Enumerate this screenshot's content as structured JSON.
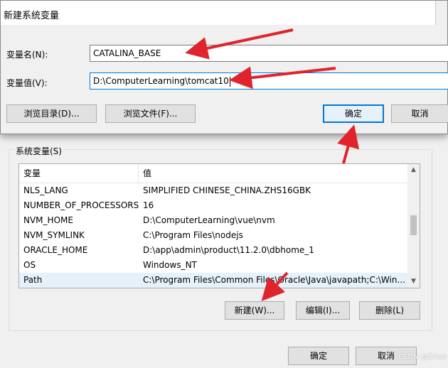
{
  "dialog": {
    "title": "新建系统变量",
    "name_label": "变量名(N):",
    "name_value": "CATALINA_BASE",
    "value_label": "变量值(V):",
    "value_value": "D:\\ComputerLearning\\tomcat10",
    "browse_dir_button": "浏览目录(D)...",
    "browse_file_button": "浏览文件(F)...",
    "ok_button": "确定",
    "cancel_button": "取消"
  },
  "system_vars": {
    "group_label": "系统变量(S)",
    "columns": [
      "变量",
      "值"
    ],
    "rows": [
      {
        "name": "NLS_LANG",
        "value": "SIMPLIFIED CHINESE_CHINA.ZHS16GBK"
      },
      {
        "name": "NUMBER_OF_PROCESSORS",
        "value": "16"
      },
      {
        "name": "NVM_HOME",
        "value": "D:\\ComputerLearning\\vue\\nvm"
      },
      {
        "name": "NVM_SYMLINK",
        "value": "C:\\Program Files\\nodejs"
      },
      {
        "name": "ORACLE_HOME",
        "value": "D:\\app\\admin\\product\\11.2.0\\dbhome_1"
      },
      {
        "name": "OS",
        "value": "Windows_NT"
      },
      {
        "name": "Path",
        "value": "C:\\Program Files\\Common Files\\Oracle\\Java\\javapath;C:\\Win..."
      }
    ],
    "new_button": "新建(W)...",
    "edit_button": "编辑(I)...",
    "delete_button": "删除(L)"
  },
  "footer": {
    "ok_button": "确定",
    "cancel_button": "取消"
  },
  "watermark": "CSDN @Zrlue",
  "colors": {
    "accent": "#0078d7",
    "annotation_arrow": "#e0242c"
  }
}
